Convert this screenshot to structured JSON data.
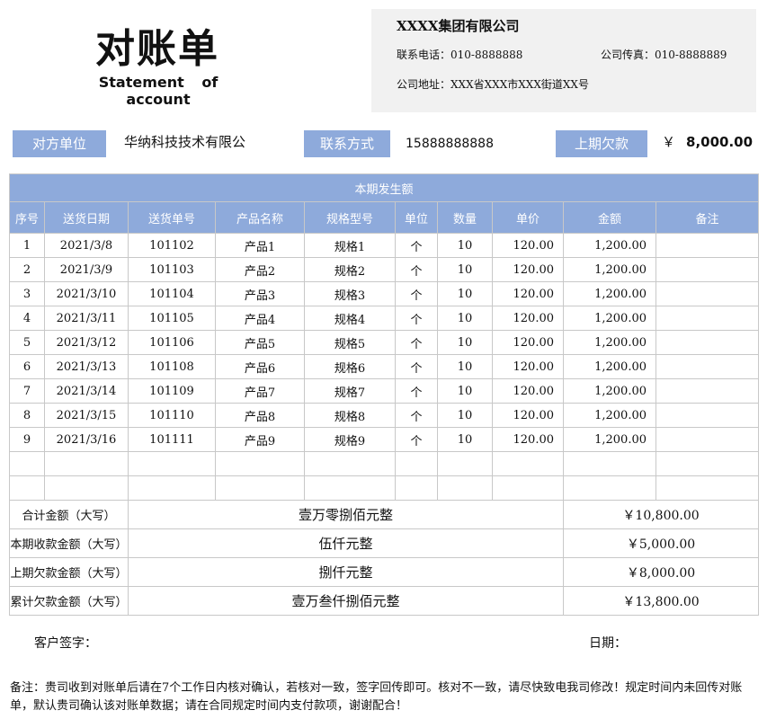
{
  "header": {
    "title_cn": "对账单",
    "title_en": "Statement of account"
  },
  "company": {
    "name": "XXXX集团有限公司",
    "phone": "联系电话：010-8888888",
    "fax": "公司传真：010-8888889",
    "address": "公司地址：XXX省XXX市XXX街道XX号"
  },
  "info": {
    "party_label": "对方单位",
    "party_value": "华纳科技技术有限公",
    "contact_label": "联系方式",
    "contact_value": "15888888888",
    "prev_debt_label": "上期欠款",
    "prev_debt_symbol": "￥",
    "prev_debt_value": "8,000.00"
  },
  "table": {
    "band_title": "本期发生额",
    "columns": [
      "序号",
      "送货日期",
      "送货单号",
      "产品名称",
      "规格型号",
      "单位",
      "数量",
      "单价",
      "金额",
      "备注"
    ],
    "rows": [
      [
        "1",
        "2021/3/8",
        "101102",
        "产品1",
        "规格1",
        "个",
        "10",
        "120.00",
        "1,200.00",
        ""
      ],
      [
        "2",
        "2021/3/9",
        "101103",
        "产品2",
        "规格2",
        "个",
        "10",
        "120.00",
        "1,200.00",
        ""
      ],
      [
        "3",
        "2021/3/10",
        "101104",
        "产品3",
        "规格3",
        "个",
        "10",
        "120.00",
        "1,200.00",
        ""
      ],
      [
        "4",
        "2021/3/11",
        "101105",
        "产品4",
        "规格4",
        "个",
        "10",
        "120.00",
        "1,200.00",
        ""
      ],
      [
        "5",
        "2021/3/12",
        "101106",
        "产品5",
        "规格5",
        "个",
        "10",
        "120.00",
        "1,200.00",
        ""
      ],
      [
        "6",
        "2021/3/13",
        "101108",
        "产品6",
        "规格6",
        "个",
        "10",
        "120.00",
        "1,200.00",
        ""
      ],
      [
        "7",
        "2021/3/14",
        "101109",
        "产品7",
        "规格7",
        "个",
        "10",
        "120.00",
        "1,200.00",
        ""
      ],
      [
        "8",
        "2021/3/15",
        "101110",
        "产品8",
        "规格8",
        "个",
        "10",
        "120.00",
        "1,200.00",
        ""
      ],
      [
        "9",
        "2021/3/16",
        "101111",
        "产品9",
        "规格9",
        "个",
        "10",
        "120.00",
        "1,200.00",
        ""
      ],
      [
        "",
        "",
        "",
        "",
        "",
        "",
        "",
        "",
        "",
        ""
      ],
      [
        "",
        "",
        "",
        "",
        "",
        "",
        "",
        "",
        "",
        ""
      ]
    ],
    "summary": [
      {
        "label": "合计金额（大写）",
        "words": "壹万零捌佰元整",
        "amount": "￥10,800.00"
      },
      {
        "label": "本期收款金额（大写）",
        "words": "伍仟元整",
        "amount": "￥5,000.00"
      },
      {
        "label": "上期欠款金额（大写）",
        "words": "捌仟元整",
        "amount": "￥8,000.00"
      },
      {
        "label": "累计欠款金额（大写）",
        "words": "壹万叁仟捌佰元整",
        "amount": "￥13,800.00"
      }
    ]
  },
  "footer": {
    "customer_sign": "客户签字：",
    "date": "日期：",
    "remark": "备注：贵司收到对账单后请在7个工作日内核对确认，若核对一致，签字回传即可。核对不一致，请尽快致电我司修改！规定时间内未回传对账单，默认贵司确认该对账单数据；请在合同规定时间内支付款项，谢谢配合！"
  }
}
